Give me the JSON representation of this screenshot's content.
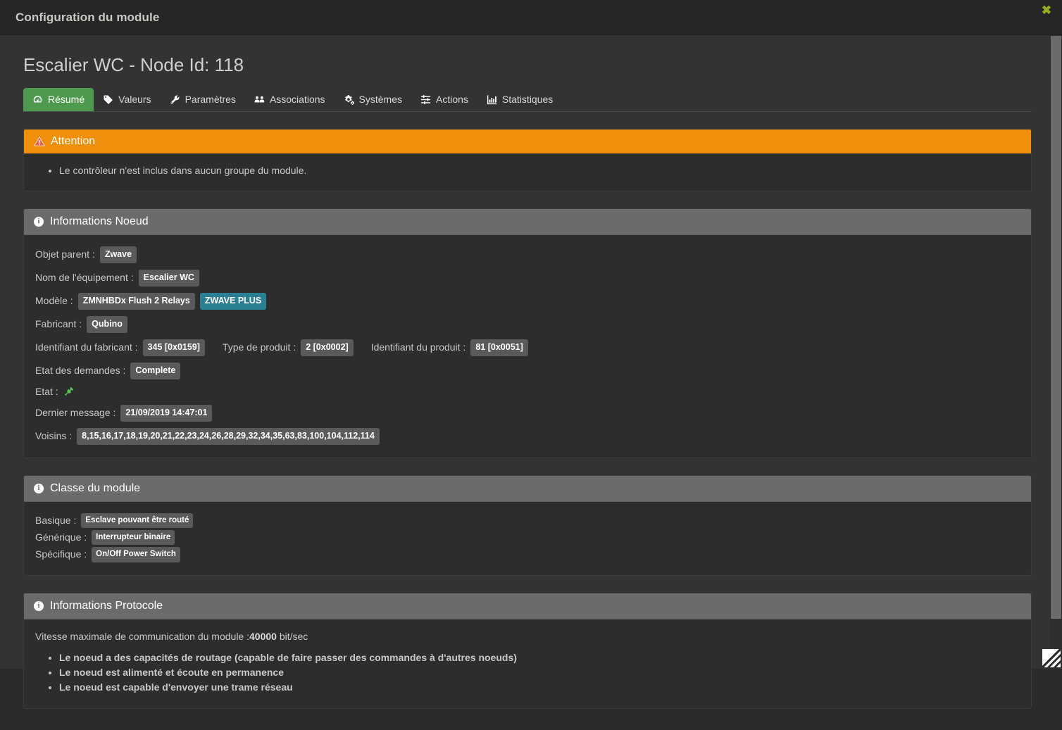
{
  "window": {
    "title": "Configuration du module",
    "close_label": "✖"
  },
  "page": {
    "title": "Escalier WC - Node Id: 118"
  },
  "tabs": [
    {
      "label": "Résumé",
      "icon": "dashboard-icon",
      "active": true
    },
    {
      "label": "Valeurs",
      "icon": "tag-icon",
      "active": false
    },
    {
      "label": "Paramètres",
      "icon": "wrench-icon",
      "active": false
    },
    {
      "label": "Associations",
      "icon": "users-icon",
      "active": false
    },
    {
      "label": "Systèmes",
      "icon": "cogs-icon",
      "active": false
    },
    {
      "label": "Actions",
      "icon": "sliders-icon",
      "active": false
    },
    {
      "label": "Statistiques",
      "icon": "bar-chart-icon",
      "active": false
    }
  ],
  "alert": {
    "heading": "Attention",
    "icon": "warning-triangle-icon",
    "items": [
      "Le contrôleur n'est inclus dans aucun groupe du module."
    ]
  },
  "node_info": {
    "heading": "Informations Noeud",
    "icon": "info-circle-icon",
    "objet_parent_label": "Objet parent :",
    "objet_parent_value": "Zwave",
    "nom_equipement_label": "Nom de l'équipement :",
    "nom_equipement_value": "Escalier WC",
    "modele_label": "Modèle :",
    "modele_value": "ZMNHBDx Flush 2 Relays",
    "modele_badge": "ZWAVE PLUS",
    "fabricant_label": "Fabricant :",
    "fabricant_value": "Qubino",
    "id_fabricant_label": "Identifiant du fabricant :",
    "id_fabricant_value": "345 [0x0159]",
    "type_produit_label": "Type de produit :",
    "type_produit_value": "2 [0x0002]",
    "id_produit_label": "Identifiant du produit :",
    "id_produit_value": "81 [0x0051]",
    "etat_demandes_label": "Etat des demandes :",
    "etat_demandes_value": "Complete",
    "etat_label": "Etat :",
    "etat_icon": "power-plug-icon",
    "dernier_message_label": "Dernier message :",
    "dernier_message_value": "21/09/2019 14:47:01",
    "voisins_label": "Voisins :",
    "voisins_value": "8,15,16,17,18,19,20,21,22,23,24,26,28,29,32,34,35,63,83,100,104,112,114"
  },
  "module_class": {
    "heading": "Classe du module",
    "icon": "info-circle-icon",
    "basique_label": "Basique :",
    "basique_value": "Esclave pouvant être routé",
    "generique_label": "Générique :",
    "generique_value": "Interrupteur binaire",
    "specifique_label": "Spécifique :",
    "specifique_value": "On/Off Power Switch"
  },
  "protocol_info": {
    "heading": "Informations Protocole",
    "icon": "info-circle-icon",
    "speed_prefix": "Vitesse maximale de communication du module :",
    "speed_value": "40000",
    "speed_suffix": " bit/sec",
    "items": [
      "Le noeud a des capacités de routage (capable de faire passer des commandes à d'autres noeuds)",
      "Le noeud est alimenté et écoute en permanence",
      "Le noeud est capable d'envoyer une trame réseau"
    ]
  },
  "colors": {
    "accent_green": "#4e9a4e",
    "alert_orange": "#ef8f0c",
    "badge_gray": "#5a5a5a",
    "badge_info": "#2a7f93",
    "panel_header": "#6b6b6b",
    "close_green": "#9aaa22",
    "status_green": "#5cc45c"
  }
}
